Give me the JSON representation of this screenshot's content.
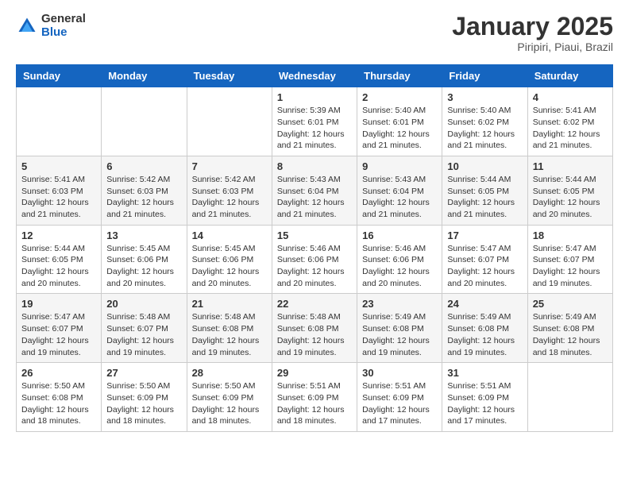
{
  "logo": {
    "general": "General",
    "blue": "Blue"
  },
  "title": "January 2025",
  "subtitle": "Piripiri, Piaui, Brazil",
  "headers": [
    "Sunday",
    "Monday",
    "Tuesday",
    "Wednesday",
    "Thursday",
    "Friday",
    "Saturday"
  ],
  "weeks": [
    [
      {
        "day": "",
        "info": ""
      },
      {
        "day": "",
        "info": ""
      },
      {
        "day": "",
        "info": ""
      },
      {
        "day": "1",
        "info": "Sunrise: 5:39 AM\nSunset: 6:01 PM\nDaylight: 12 hours\nand 21 minutes."
      },
      {
        "day": "2",
        "info": "Sunrise: 5:40 AM\nSunset: 6:01 PM\nDaylight: 12 hours\nand 21 minutes."
      },
      {
        "day": "3",
        "info": "Sunrise: 5:40 AM\nSunset: 6:02 PM\nDaylight: 12 hours\nand 21 minutes."
      },
      {
        "day": "4",
        "info": "Sunrise: 5:41 AM\nSunset: 6:02 PM\nDaylight: 12 hours\nand 21 minutes."
      }
    ],
    [
      {
        "day": "5",
        "info": "Sunrise: 5:41 AM\nSunset: 6:03 PM\nDaylight: 12 hours\nand 21 minutes."
      },
      {
        "day": "6",
        "info": "Sunrise: 5:42 AM\nSunset: 6:03 PM\nDaylight: 12 hours\nand 21 minutes."
      },
      {
        "day": "7",
        "info": "Sunrise: 5:42 AM\nSunset: 6:03 PM\nDaylight: 12 hours\nand 21 minutes."
      },
      {
        "day": "8",
        "info": "Sunrise: 5:43 AM\nSunset: 6:04 PM\nDaylight: 12 hours\nand 21 minutes."
      },
      {
        "day": "9",
        "info": "Sunrise: 5:43 AM\nSunset: 6:04 PM\nDaylight: 12 hours\nand 21 minutes."
      },
      {
        "day": "10",
        "info": "Sunrise: 5:44 AM\nSunset: 6:05 PM\nDaylight: 12 hours\nand 21 minutes."
      },
      {
        "day": "11",
        "info": "Sunrise: 5:44 AM\nSunset: 6:05 PM\nDaylight: 12 hours\nand 20 minutes."
      }
    ],
    [
      {
        "day": "12",
        "info": "Sunrise: 5:44 AM\nSunset: 6:05 PM\nDaylight: 12 hours\nand 20 minutes."
      },
      {
        "day": "13",
        "info": "Sunrise: 5:45 AM\nSunset: 6:06 PM\nDaylight: 12 hours\nand 20 minutes."
      },
      {
        "day": "14",
        "info": "Sunrise: 5:45 AM\nSunset: 6:06 PM\nDaylight: 12 hours\nand 20 minutes."
      },
      {
        "day": "15",
        "info": "Sunrise: 5:46 AM\nSunset: 6:06 PM\nDaylight: 12 hours\nand 20 minutes."
      },
      {
        "day": "16",
        "info": "Sunrise: 5:46 AM\nSunset: 6:06 PM\nDaylight: 12 hours\nand 20 minutes."
      },
      {
        "day": "17",
        "info": "Sunrise: 5:47 AM\nSunset: 6:07 PM\nDaylight: 12 hours\nand 20 minutes."
      },
      {
        "day": "18",
        "info": "Sunrise: 5:47 AM\nSunset: 6:07 PM\nDaylight: 12 hours\nand 19 minutes."
      }
    ],
    [
      {
        "day": "19",
        "info": "Sunrise: 5:47 AM\nSunset: 6:07 PM\nDaylight: 12 hours\nand 19 minutes."
      },
      {
        "day": "20",
        "info": "Sunrise: 5:48 AM\nSunset: 6:07 PM\nDaylight: 12 hours\nand 19 minutes."
      },
      {
        "day": "21",
        "info": "Sunrise: 5:48 AM\nSunset: 6:08 PM\nDaylight: 12 hours\nand 19 minutes."
      },
      {
        "day": "22",
        "info": "Sunrise: 5:48 AM\nSunset: 6:08 PM\nDaylight: 12 hours\nand 19 minutes."
      },
      {
        "day": "23",
        "info": "Sunrise: 5:49 AM\nSunset: 6:08 PM\nDaylight: 12 hours\nand 19 minutes."
      },
      {
        "day": "24",
        "info": "Sunrise: 5:49 AM\nSunset: 6:08 PM\nDaylight: 12 hours\nand 19 minutes."
      },
      {
        "day": "25",
        "info": "Sunrise: 5:49 AM\nSunset: 6:08 PM\nDaylight: 12 hours\nand 18 minutes."
      }
    ],
    [
      {
        "day": "26",
        "info": "Sunrise: 5:50 AM\nSunset: 6:08 PM\nDaylight: 12 hours\nand 18 minutes."
      },
      {
        "day": "27",
        "info": "Sunrise: 5:50 AM\nSunset: 6:09 PM\nDaylight: 12 hours\nand 18 minutes."
      },
      {
        "day": "28",
        "info": "Sunrise: 5:50 AM\nSunset: 6:09 PM\nDaylight: 12 hours\nand 18 minutes."
      },
      {
        "day": "29",
        "info": "Sunrise: 5:51 AM\nSunset: 6:09 PM\nDaylight: 12 hours\nand 18 minutes."
      },
      {
        "day": "30",
        "info": "Sunrise: 5:51 AM\nSunset: 6:09 PM\nDaylight: 12 hours\nand 17 minutes."
      },
      {
        "day": "31",
        "info": "Sunrise: 5:51 AM\nSunset: 6:09 PM\nDaylight: 12 hours\nand 17 minutes."
      },
      {
        "day": "",
        "info": ""
      }
    ]
  ]
}
